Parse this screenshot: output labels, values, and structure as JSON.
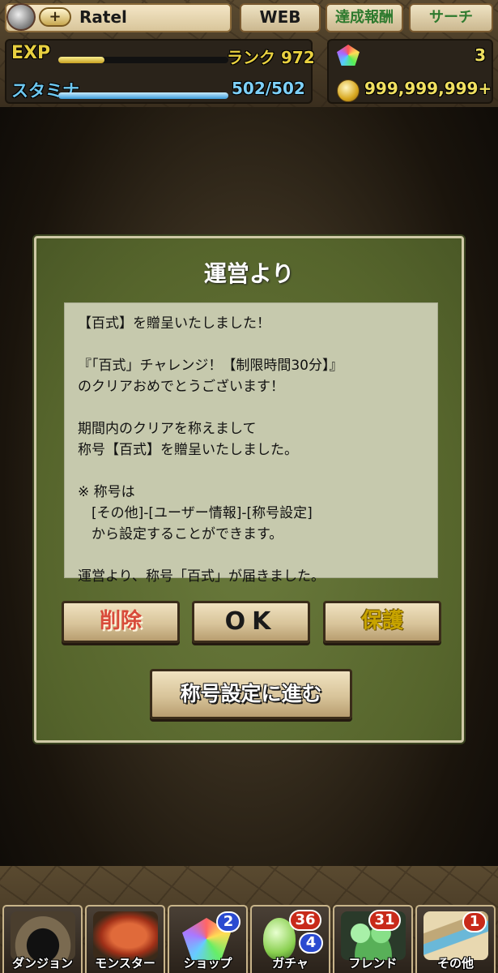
{
  "header": {
    "player_name": "Ratel",
    "plus_symbol": "+",
    "buttons": {
      "web": "WEB",
      "achievements": "達成報酬",
      "search": "サーチ"
    },
    "exp_label": "EXP",
    "rank_text": "ランク 972",
    "stamina_label": "スタミナ",
    "stamina_text": "502/502",
    "exp_progress": 0.27,
    "stamina_progress": 1.0,
    "magic_stones": "3",
    "coins": "999,999,999+"
  },
  "dialog": {
    "title": "運営より",
    "message_lines": [
      "【百式】を贈呈いたしました！",
      "",
      "『「百式」チャレンジ！【制限時間30分】』",
      "のクリアおめでとうございます！",
      "",
      "期間内のクリアを称えまして",
      "称号【百式】を贈呈いたしました。",
      "",
      "※ 称号は",
      "　[その他]-[ユーザー情報]-[称号設定]",
      "　から設定することができます。",
      "",
      "運営より、称号「百式」が届きました。"
    ],
    "buttons": {
      "delete": "削除",
      "ok": "OK",
      "protect": "保護",
      "title_settings": "称号設定に進む"
    }
  },
  "nav": {
    "tabs": [
      {
        "label": "ダンジョン"
      },
      {
        "label": "モンスター"
      },
      {
        "label": "ショップ",
        "badge": "2"
      },
      {
        "label": "ガチャ",
        "badge_top": "36",
        "badge_bottom": "4"
      },
      {
        "label": "フレンド",
        "badge": "31"
      },
      {
        "label": "その他",
        "badge": "1"
      }
    ]
  },
  "colors": {
    "dialog_bg": "#56652c",
    "message_bg": "#c6c9ad",
    "delete_text": "#d84a3a",
    "protect_text": "#c8a400",
    "stamina_blue": "#6ec8f0",
    "exp_yellow": "#e8d040"
  },
  "icons": {
    "avatar": "player-avatar-icon",
    "stone": "magic-stone-icon",
    "coin": "coin-icon"
  }
}
